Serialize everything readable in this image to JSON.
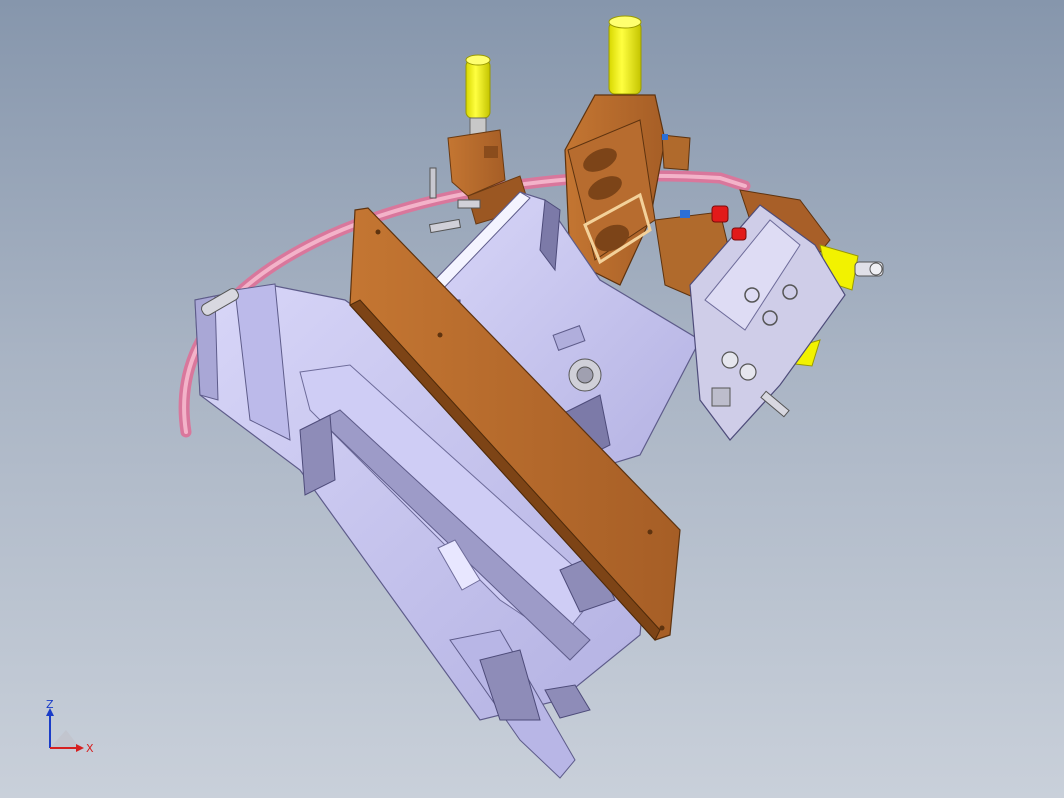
{
  "viewport": {
    "background_top": "#8696ac",
    "background_bottom": "#c9d0da"
  },
  "model": {
    "colors": {
      "frame_lavender": "#c6c4f0",
      "frame_shadow": "#8e8cb8",
      "wood_brown": "#b66a2e",
      "wood_dark": "#7d4416",
      "cylinder_yellow": "#f2f200",
      "cable_pink": "#e08aa8",
      "accent_red": "#e21a1a",
      "accent_blue": "#2c6fd6"
    }
  },
  "triad": {
    "z_label": "Z",
    "x_label": "X",
    "z_color": "#1a3cc8",
    "x_color": "#d62020"
  }
}
